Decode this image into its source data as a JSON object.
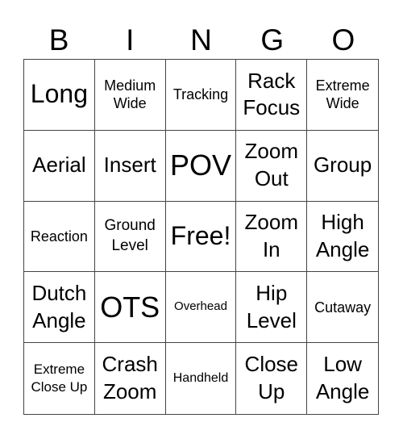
{
  "header": [
    "B",
    "I",
    "N",
    "G",
    "O"
  ],
  "cells": [
    [
      "Long",
      "Medium Wide",
      "Tracking",
      "Rack Focus",
      "Extreme Wide"
    ],
    [
      "Aerial",
      "Insert",
      "POV",
      "Zoom Out",
      "Group"
    ],
    [
      "Reaction",
      "Ground Level",
      "Free!",
      "Zoom In",
      "High Angle"
    ],
    [
      "Dutch Angle",
      "OTS",
      "Overhead",
      "Hip Level",
      "Cutaway"
    ],
    [
      "Extreme Close Up",
      "Crash Zoom",
      "Handheld",
      "Close Up",
      "Low Angle"
    ]
  ]
}
